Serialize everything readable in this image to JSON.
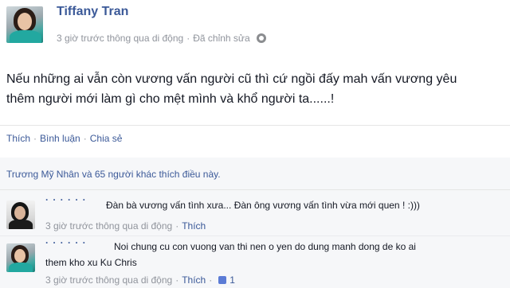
{
  "post": {
    "author": "Tiffany Tran",
    "time": "3 giờ trước thông qua di động",
    "edited": "Đã chỉnh sửa",
    "text_line1": "Nếu những ai vẫn còn vương vấn người cũ thì cứ ngồi đấy mah vấn vương yêu",
    "text_line2": "thêm người mới làm gì cho mệt mình và khổ người ta......!"
  },
  "actions": {
    "like": "Thích",
    "comment": "Bình luận",
    "share": "Chia sẻ"
  },
  "likes_summary": {
    "text": "Trương Mỹ Nhân và 65 người khác thích điều này."
  },
  "comments": [
    {
      "author": "·  ·  ·  ·  ·  ·",
      "text": "Đàn bà vương vấn tình xưa... Đàn ông vương vấn tình vừa mới quen ! :)))",
      "time": "3 giờ trước thông qua di động",
      "like": "Thích"
    },
    {
      "author": "·  ·  ·  ·  ·  ·",
      "text_line1": "Noi chung cu con vuong van thi nen o yen do dung manh dong de ko ai",
      "text_line2": "them kho xu Ku Chris",
      "time": "3 giờ trước thông qua di động",
      "like": "Thích",
      "likes_count": "1"
    }
  ],
  "icons": {
    "privacy": "gear-icon",
    "comment_like": "thumbs-up-icon"
  },
  "colors": {
    "link": "#3b5998",
    "muted": "#90949c",
    "text": "#141823",
    "panel": "#f6f7f9"
  }
}
